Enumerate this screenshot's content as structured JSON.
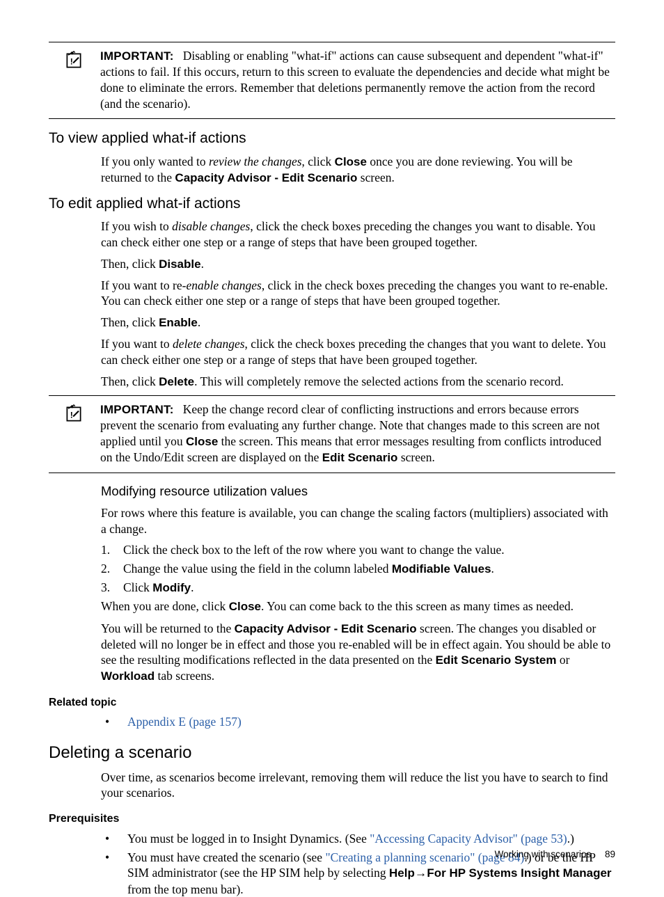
{
  "notes": {
    "important_label": "IMPORTANT:",
    "note1_body": "Disabling or enabling \"what-if\" actions can cause subsequent and dependent \"what-if\" actions to fail. If this occurs, return to this screen to evaluate the dependencies and decide what might be done to eliminate the errors. Remember that deletions permanently remove the action from the record (and the scenario).",
    "note2_body_a": "Keep the change record clear of conflicting instructions and errors because errors prevent the scenario from evaluating any further change. Note that changes made to this screen are not applied until you ",
    "note2_close": "Close",
    "note2_body_b": " the screen. This means that error messages resulting from conflicts introduced on the Undo/Edit screen are displayed on the ",
    "note2_edit_scenario": "Edit Scenario",
    "note2_body_c": " screen."
  },
  "sections": {
    "view_title": "To view applied what-if actions",
    "edit_title": "To edit applied what-if actions",
    "modify_title": "Modifying resource utilization values",
    "delete_title": "Deleting a scenario",
    "related_title": "Related topic",
    "prereq_title": "Prerequisites"
  },
  "view": {
    "p_a": "If you only wanted to ",
    "review_phrase": "review the changes",
    "p_b": ", click ",
    "close_label": "Close",
    "p_c": " once you are done reviewing. You will be returned to the ",
    "screen_name": "Capacity Advisor - Edit Scenario",
    "p_d": " screen."
  },
  "edit": {
    "p1_a": "If you wish to ",
    "disable_phrase": "disable changes",
    "p1_b": ", click the check boxes preceding the changes you want to disable. You can check either one step or a range of steps that have been grouped together.",
    "then_click": "Then, click ",
    "disable_label": "Disable",
    "period": ".",
    "p2_a": "If you want to re-",
    "enable_phrase": "enable changes",
    "p2_b": ", click in the check boxes preceding the changes you want to re-enable. You can check either one step or a range of steps that have been grouped together.",
    "enable_label": "Enable",
    "p3_a": "If you want to ",
    "delete_phrase": "delete changes",
    "p3_b": ", click the check boxes preceding the changes that you want to delete. You can check either one step or a range of steps that have been grouped together.",
    "delete_label": "Delete",
    "delete_tail": ". This will completely remove the selected actions from the scenario record."
  },
  "modify": {
    "intro": "For rows where this feature is available, you can change the scaling factors (multipliers) associated with a change.",
    "steps": [
      "Click the check box to the left of the row where you want to change the value.",
      "Change the value using the field in the column labeled ",
      "Click "
    ],
    "mod_values_label": "Modifiable Values",
    "modify_label": "Modify",
    "done_a": "When you are done, click ",
    "close_label": "Close",
    "done_b": ". You can come back to the this screen as many times as needed.",
    "return_a": "You will be returned to the ",
    "cap_adv_label": "Capacity Advisor - Edit Scenario",
    "return_b": " screen. The changes you disabled or deleted will no longer be in effect and those you re-enabled will be in effect again. You should be able to see the resulting modifications reflected in the data presented on the ",
    "edit_sys_label": "Edit Scenario System",
    "or": " or ",
    "workload_label": "Workload",
    "return_c": " tab screens."
  },
  "related": {
    "link_text": "Appendix E (page 157)"
  },
  "delete": {
    "intro": "Over time, as scenarios become irrelevant, removing them will reduce the list you have to search to find your scenarios.",
    "pre1_a": "You must be logged in to Insight Dynamics. (See ",
    "pre1_link": "\"Accessing Capacity Advisor\" (page 53)",
    "pre1_b": ".)",
    "pre2_a": "You must have created the scenario (see ",
    "pre2_link": "\"Creating a planning scenario\" (page 84)",
    "pre2_b": ".) or be the HP SIM administrator (see the HP SIM help by selecting ",
    "help_label": "Help",
    "arrow": "→",
    "hp_sim_label": "For HP Systems Insight Manager",
    "pre2_c": " from the top menu bar)."
  },
  "footer": {
    "text": "Working with scenarios",
    "page": "89"
  }
}
